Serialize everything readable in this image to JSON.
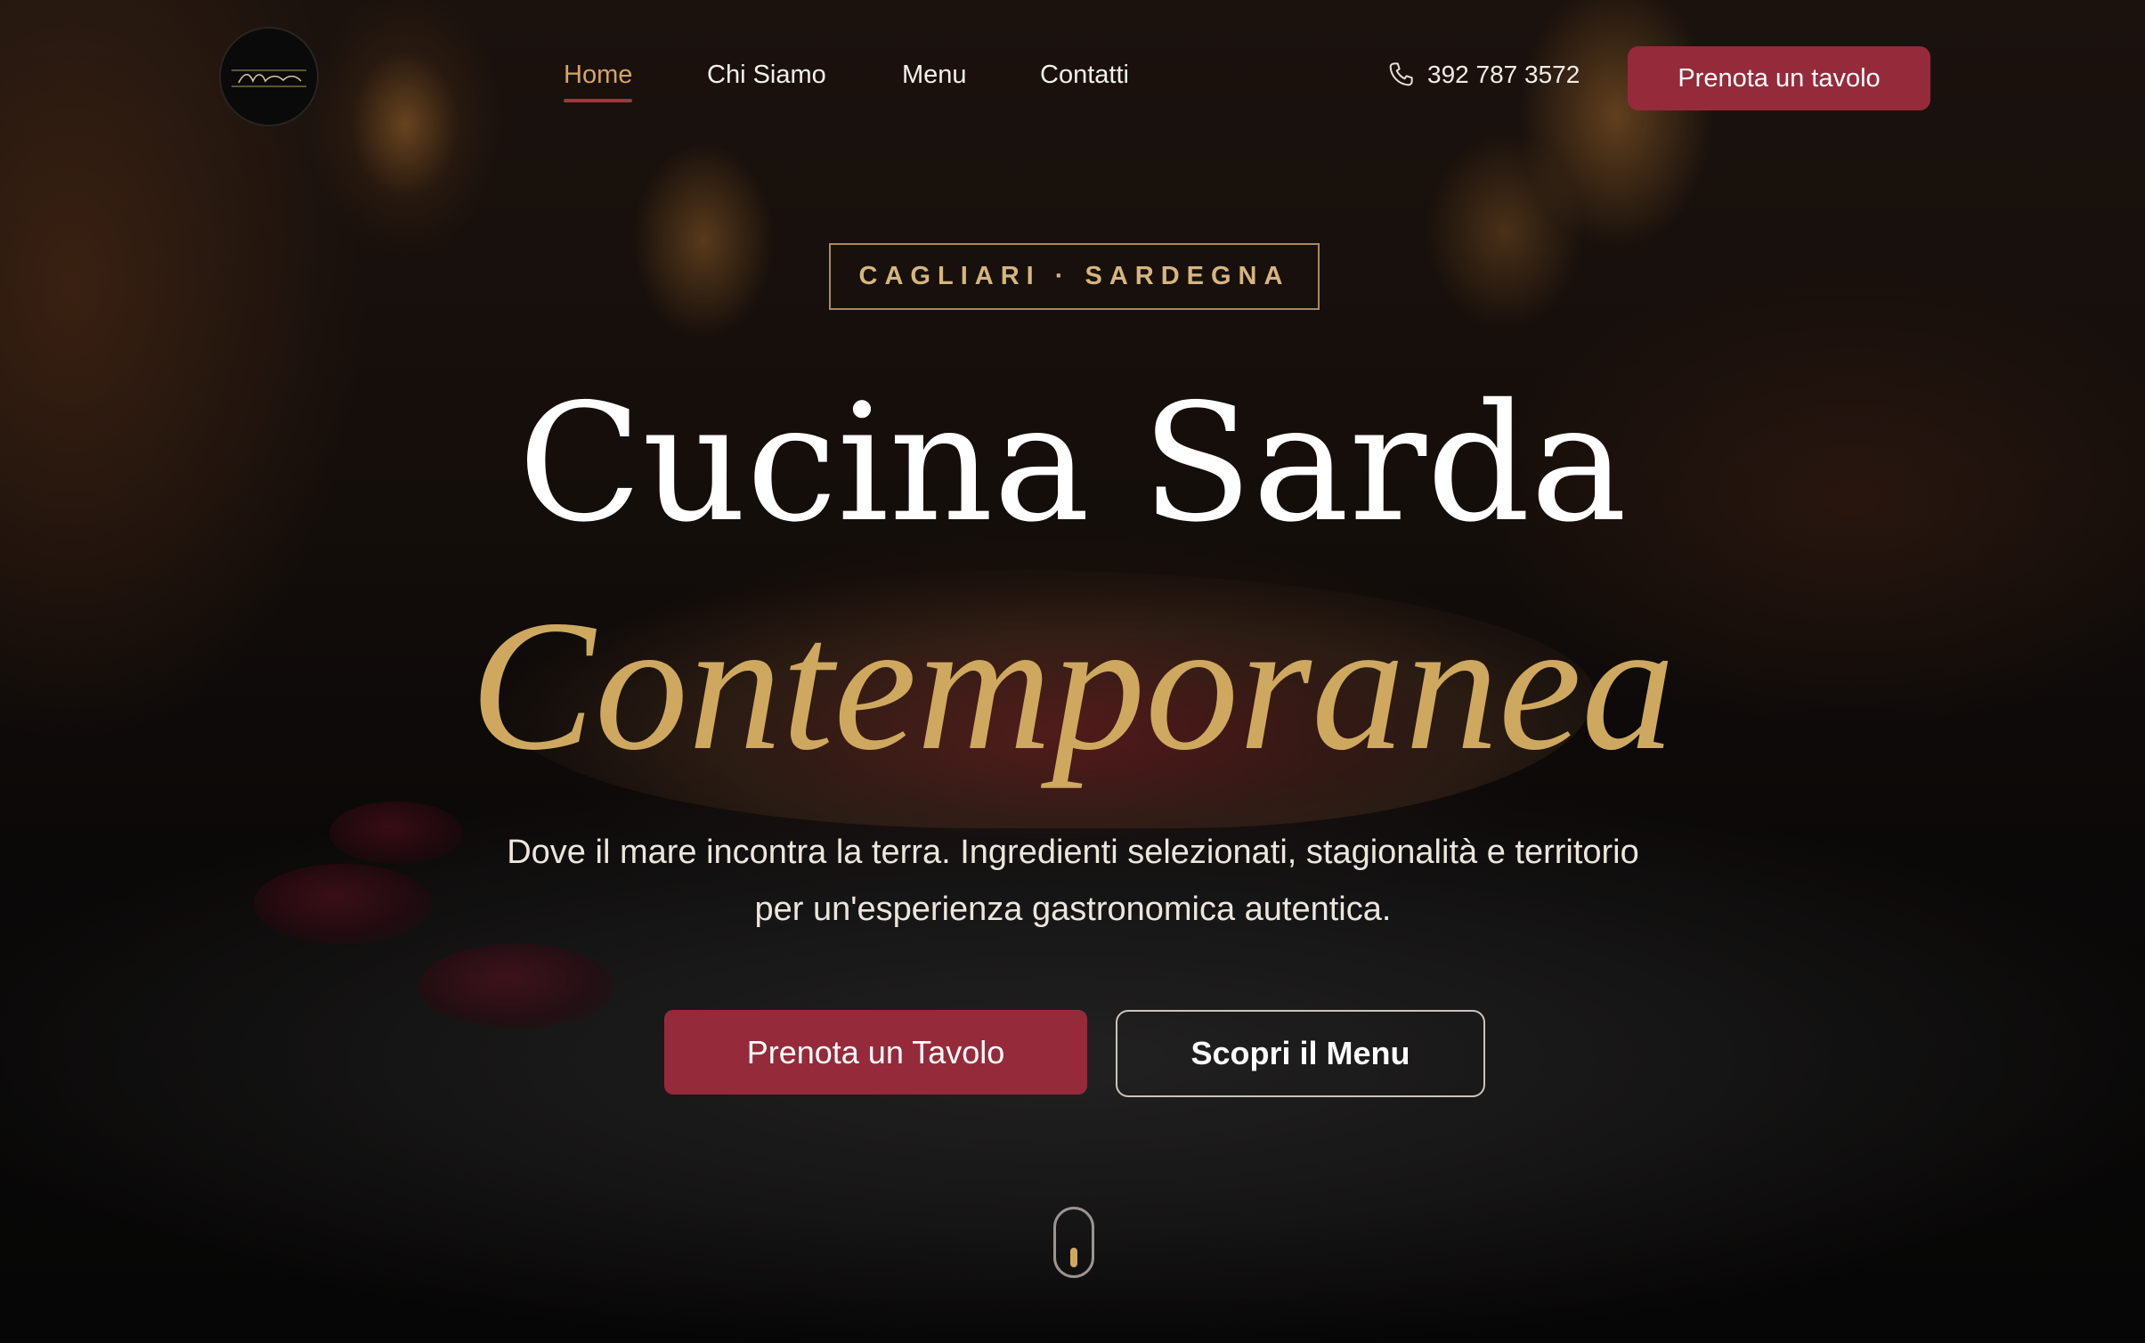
{
  "nav": {
    "items": [
      {
        "label": "Home",
        "active": true
      },
      {
        "label": "Chi Siamo",
        "active": false
      },
      {
        "label": "Menu",
        "active": false
      },
      {
        "label": "Contatti",
        "active": false
      }
    ],
    "phone": "392 787 3572",
    "phone_icon": "phone-icon",
    "cta_label": "Prenota un tavolo"
  },
  "hero": {
    "location": "CAGLIARI · SARDEGNA",
    "title_line1": "Cucina Sarda",
    "title_line2": "Contemporanea",
    "subtitle": "Dove il mare incontra la terra. Ingredienti selezionati, stagionalità e territorio per un'esperienza gastronomica autentica.",
    "primary_button": "Prenota un Tavolo",
    "secondary_button": "Scopri il Menu"
  },
  "colors": {
    "accent_red": "#952b3a",
    "accent_gold": "#cfa860",
    "nav_active": "#d4a566"
  }
}
